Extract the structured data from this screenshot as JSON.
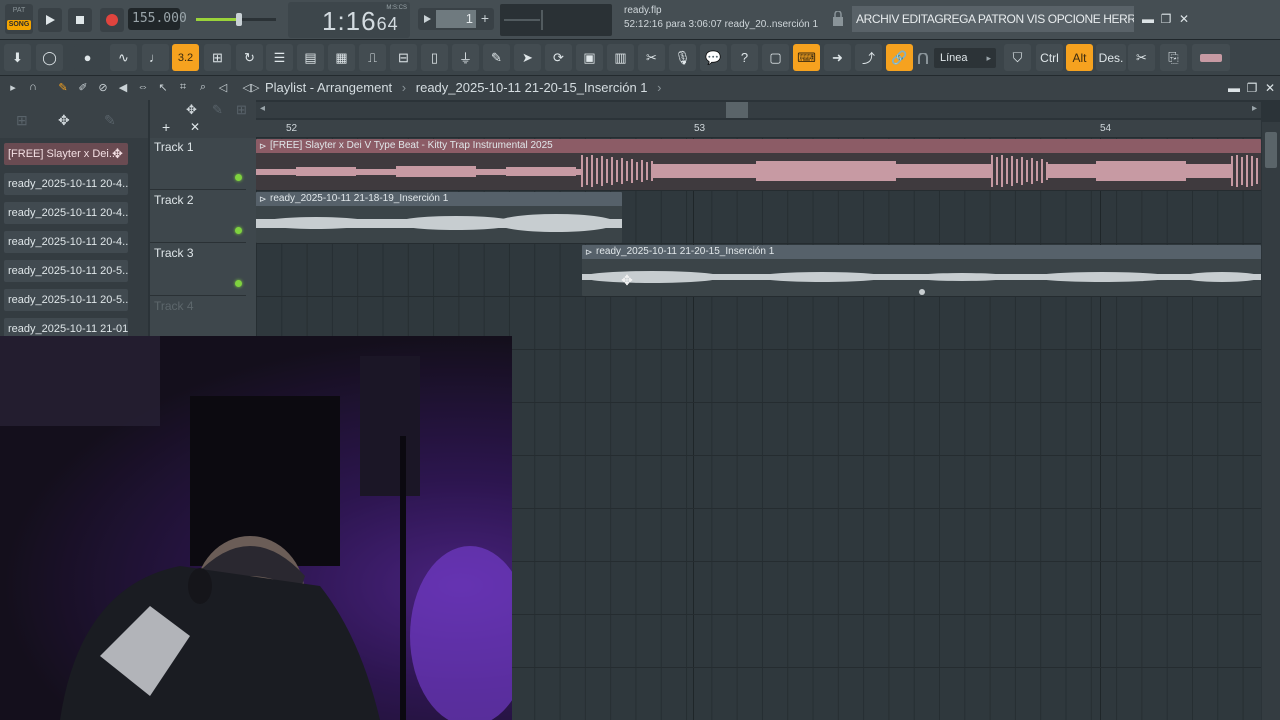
{
  "transport": {
    "pat_label": "PAT",
    "song_label": "SONG",
    "tempo": "155.000",
    "time_display": "1:16",
    "time_sub": "64",
    "time_unit": "M:S:CS",
    "pattern_number": "1"
  },
  "hint_panel": {
    "file": "ready.flp",
    "message": "52:12:16 para 3:06:07 ready_20..nserción 1"
  },
  "menu_bar": {
    "text": "ARCHIV EDITAGREGA PATRON VIS OPCIONE HERRAMIENT A"
  },
  "toolbar": {
    "snap_value": "Línea",
    "ctrl_label": "Ctrl",
    "alt_label": "Alt",
    "des_label": "Des.",
    "numeric_badge": "3.2"
  },
  "playlist": {
    "title": "Playlist - Arrangement",
    "pattern_name": "ready_2025-10-11 21-20-15_Inserción 1"
  },
  "ruler": {
    "marks": [
      "52",
      "53",
      "54"
    ]
  },
  "picker": {
    "items": [
      "[FREE] Slayter x Dei...",
      "ready_2025-10-11 20-4...",
      "ready_2025-10-11 20-4...",
      "ready_2025-10-11 20-4...",
      "ready_2025-10-11 20-5...",
      "ready_2025-10-11 20-5...",
      "ready_2025-10-11 21-01..."
    ]
  },
  "tracks": [
    {
      "name": "Track 1"
    },
    {
      "name": "Track 2"
    },
    {
      "name": "Track 3"
    },
    {
      "name": "Track 4"
    }
  ],
  "clips": [
    {
      "title": "[FREE] Slayter x Dei V Type Beat - Kitty  Trap Instrumental 2025",
      "color": "#c79aa3"
    },
    {
      "title": "ready_2025-10-11 21-18-19_Inserción 1",
      "color": "#c7cdd0"
    },
    {
      "title": "ready_2025-10-11 21-20-15_Inserción 1",
      "color": "#c7cdd0"
    }
  ],
  "colors": {
    "accent": "#f6a21f",
    "led_green": "#7fd23f",
    "clip_pink": "#c79aa3"
  }
}
